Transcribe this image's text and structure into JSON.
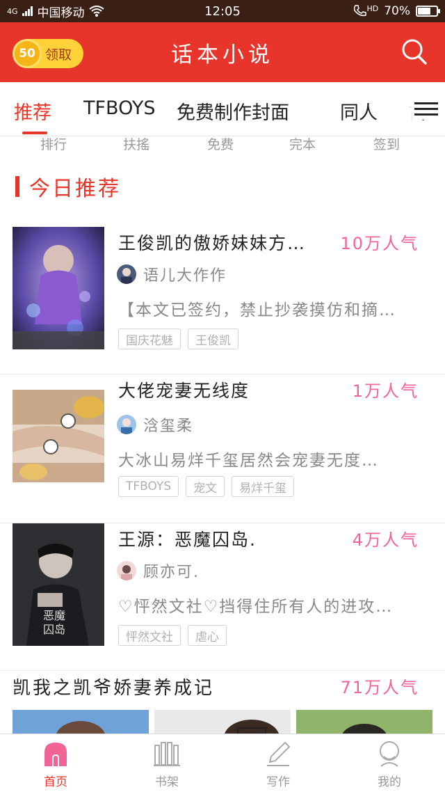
{
  "statusbar": {
    "carrier": "中国移动",
    "network": "4G",
    "time": "12:05",
    "hd": "HD",
    "battery": "70%",
    "battery_level": 0.7
  },
  "header": {
    "coin_value": "50",
    "claim_label": "领取",
    "title": "话本小说",
    "search_icon": "search-icon"
  },
  "tabs": [
    {
      "label": "推荐",
      "active": true
    },
    {
      "label": "TFBOYS"
    },
    {
      "label": "免费制作封面"
    },
    {
      "label": "同人"
    },
    {
      "label": "古"
    }
  ],
  "quick_links": [
    "排行",
    "扶搖",
    "免费",
    "完本",
    "签到"
  ],
  "section": {
    "title": "今日推荐"
  },
  "books": [
    {
      "title": "王俊凯的傲娇妹妹方…",
      "popularity": "10万人气",
      "author": "语儿大作作",
      "description": "【本文已签约，禁止抄袭摸仿和摘…",
      "tags": [
        "国庆花魅",
        "王俊凯"
      ]
    },
    {
      "title": "大佬宠妻无线度",
      "popularity": "1万人气",
      "author": "浛玺柔",
      "description": "大冰山易烊千玺居然会宠妻无度…",
      "tags": [
        "TFBOYS",
        "宠文",
        "易烊千玺"
      ]
    },
    {
      "title": "王源：恶魔囚岛.",
      "popularity": "4万人气",
      "author": "顾亦可.",
      "description": "♡怦然文社♡挡得住所有人的进攻…",
      "tags": [
        "怦然文社",
        "虐心"
      ]
    }
  ],
  "hot": {
    "title": "凯我之凯爷娇妻养成记",
    "popularity": "71万人气"
  },
  "bottom_nav": [
    {
      "label": "首页",
      "icon": "home-icon",
      "active": true
    },
    {
      "label": "书架",
      "icon": "bookshelf-icon"
    },
    {
      "label": "写作",
      "icon": "pen-icon"
    },
    {
      "label": "我的",
      "icon": "profile-icon"
    }
  ],
  "colors": {
    "brand": "#e8352b",
    "popularity": "#f06595",
    "coin": "#ffd23a"
  }
}
